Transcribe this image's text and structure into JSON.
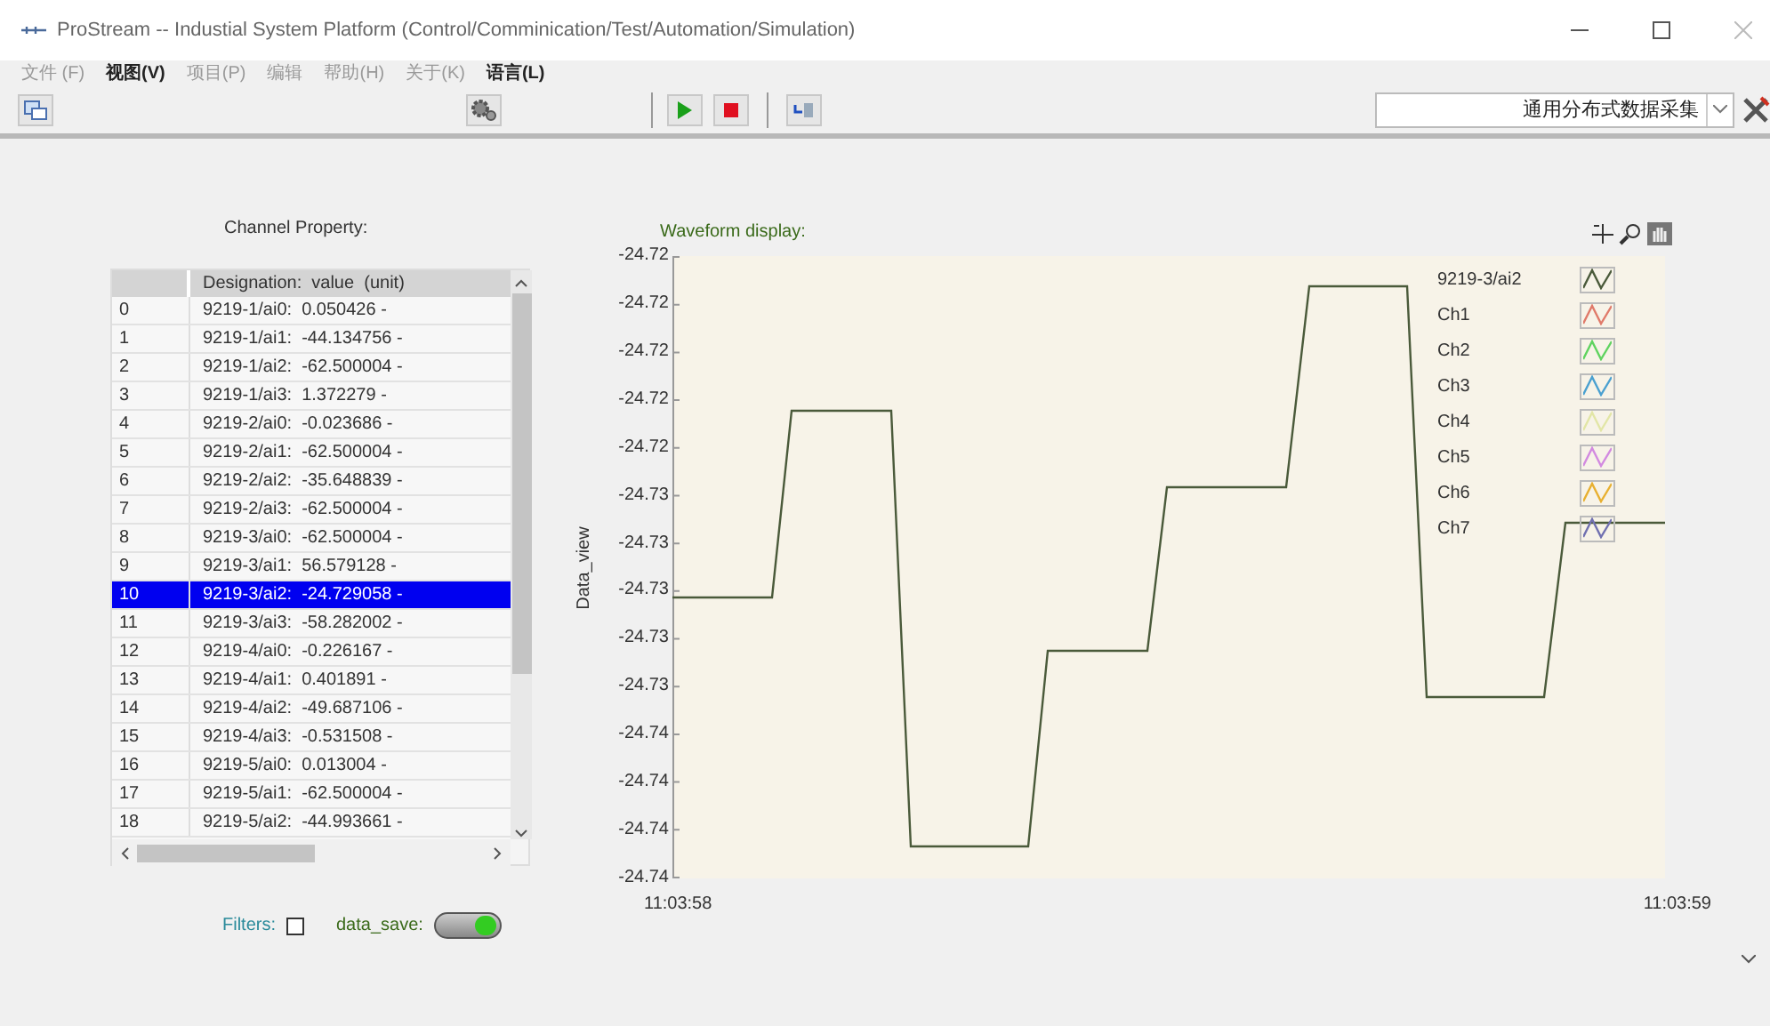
{
  "window": {
    "title": "ProStream -- Industial System Platform (Control/Comminication/Test/Automation/Simulation)"
  },
  "menu": [
    {
      "label": "文件 (F)",
      "disabled": true
    },
    {
      "label": "视图(V)",
      "disabled": false
    },
    {
      "label": "项目(P)",
      "disabled": true
    },
    {
      "label": "编辑",
      "disabled": true
    },
    {
      "label": "帮助(H)",
      "disabled": true
    },
    {
      "label": "关于(K)",
      "disabled": true
    },
    {
      "label": "语言(L)",
      "disabled": false
    }
  ],
  "toolbar": {
    "dropdown_value": "通用分布式数据采集"
  },
  "channel_panel": {
    "label": "Channel Property:",
    "column_header": "Designation:  value  (unit)",
    "rows": [
      {
        "index": "0",
        "text": "9219-1/ai0:  0.050426 -",
        "selected": false
      },
      {
        "index": "1",
        "text": "9219-1/ai1:  -44.134756 -",
        "selected": false
      },
      {
        "index": "2",
        "text": "9219-1/ai2:  -62.500004 -",
        "selected": false
      },
      {
        "index": "3",
        "text": "9219-1/ai3:  1.372279 -",
        "selected": false
      },
      {
        "index": "4",
        "text": "9219-2/ai0:  -0.023686 -",
        "selected": false
      },
      {
        "index": "5",
        "text": "9219-2/ai1:  -62.500004 -",
        "selected": false
      },
      {
        "index": "6",
        "text": "9219-2/ai2:  -35.648839 -",
        "selected": false
      },
      {
        "index": "7",
        "text": "9219-2/ai3:  -62.500004 -",
        "selected": false
      },
      {
        "index": "8",
        "text": "9219-3/ai0:  -62.500004 -",
        "selected": false
      },
      {
        "index": "9",
        "text": "9219-3/ai1:  56.579128 -",
        "selected": false
      },
      {
        "index": "10",
        "text": "9219-3/ai2:  -24.729058 -",
        "selected": true
      },
      {
        "index": "11",
        "text": "9219-3/ai3:  -58.282002 -",
        "selected": false
      },
      {
        "index": "12",
        "text": "9219-4/ai0:  -0.226167 -",
        "selected": false
      },
      {
        "index": "13",
        "text": "9219-4/ai1:  0.401891 -",
        "selected": false
      },
      {
        "index": "14",
        "text": "9219-4/ai2:  -49.687106 -",
        "selected": false
      },
      {
        "index": "15",
        "text": "9219-4/ai3:  -0.531508 -",
        "selected": false
      },
      {
        "index": "16",
        "text": "9219-5/ai0:  0.013004 -",
        "selected": false
      },
      {
        "index": "17",
        "text": "9219-5/ai1:  -62.500004 -",
        "selected": false
      },
      {
        "index": "18",
        "text": "9219-5/ai2:  -44.993661 -",
        "selected": false
      }
    ]
  },
  "filters": {
    "label": "Filters:",
    "checked": false
  },
  "data_save": {
    "label": "data_save:",
    "on": true
  },
  "waveform": {
    "label": "Waveform display:",
    "ylabel": "Data_view",
    "yticks": [
      "-24.72",
      "-24.72",
      "-24.72",
      "-24.72",
      "-24.72",
      "-24.73",
      "-24.73",
      "-24.73",
      "-24.73",
      "-24.73",
      "-24.74",
      "-24.74",
      "-24.74",
      "-24.74"
    ],
    "xticks": [
      "11:03:58",
      "11:03:59"
    ],
    "legend": [
      {
        "name": "9219-3/ai2",
        "color": "#4a5a3a"
      },
      {
        "name": "Ch1",
        "color": "#e07a6a"
      },
      {
        "name": "Ch2",
        "color": "#5fd35f"
      },
      {
        "name": "Ch3",
        "color": "#4aa0d0"
      },
      {
        "name": "Ch4",
        "color": "#e2e6a6"
      },
      {
        "name": "Ch5",
        "color": "#d28ae0"
      },
      {
        "name": "Ch6",
        "color": "#e8b030"
      },
      {
        "name": "Ch7",
        "color": "#7070b0"
      }
    ]
  }
}
